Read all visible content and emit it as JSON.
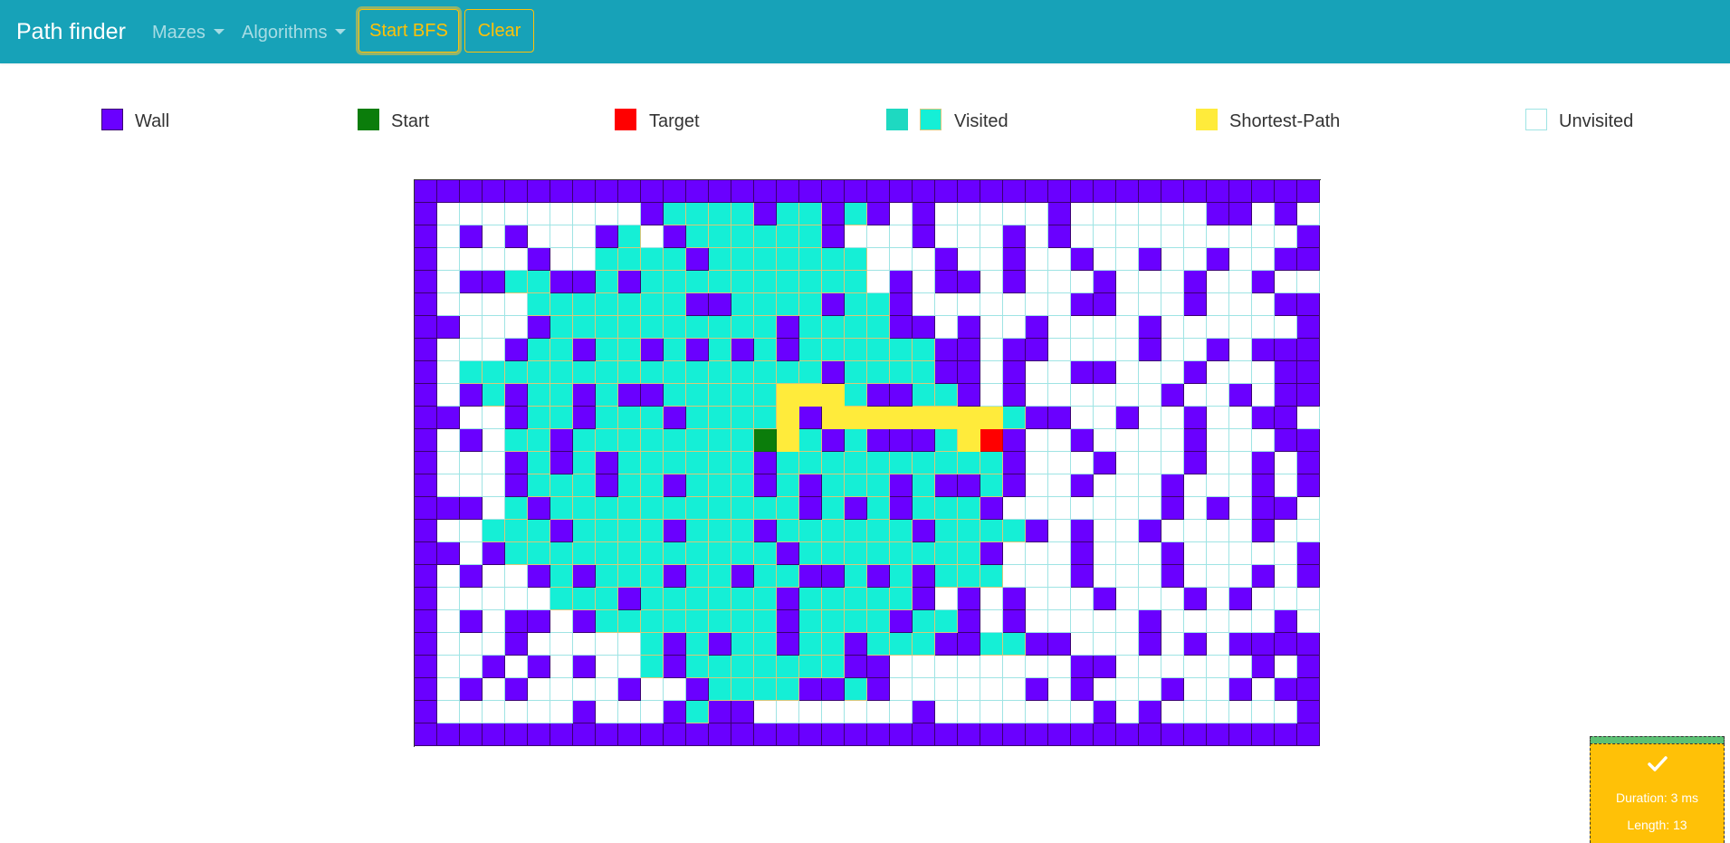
{
  "app": {
    "brand": "Path finder"
  },
  "nav": {
    "mazes": "Mazes",
    "algorithms": "Algorithms",
    "start_button": "Start BFS",
    "clear_button": "Clear"
  },
  "legend": {
    "wall": "Wall",
    "start": "Start",
    "target": "Target",
    "visited": "Visited",
    "shortest_path": "Shortest-Path",
    "unvisited": "Unvisited"
  },
  "colors": {
    "navbar": "#17a2b8",
    "button_accent": "#ffc107",
    "wall": "#6a00ff",
    "start": "#0b7d0b",
    "target": "#ff0000",
    "visited": "#15efd6",
    "visited_alt": "#1ed9c1",
    "shortest_path": "#ffeb3b",
    "unvisited_border": "#9fe4e4"
  },
  "grid": {
    "columns": 40,
    "rows": 25,
    "legend_key": "W wall, S start, T target, V visited, P shortest path, . unvisited",
    "cells": [
      "WWWWWWWWWWWWWWWWWWWWWWWWWWWWWWWWWWWWWWWW",
      "W.........WVVVVWVVWVW.W.....W......WW.W.W",
      "W.W.W...WV.WVVVVVVW...W...W.W..........W",
      "W....W..VVVVWVVVVVVV...W..W..W..W..W..WW",
      "W.WWVVWWVWVVVVVVVVVV.W.WW.W...W...W..W..",
      "W....VVVVVVVWWVVVVWVVW.......WW...W...WW",
      "WW...WVVVVVVVVVVWVVVVWW.W..W....W......W",
      "W...WVVWVVWVWVWVWVVVVVVWW.WW....W..W.WWW",
      "W.VVVVVVVVVVVVVVVVWVVVVWW.W..WW...W...WW",
      "W.WVWVVWVWWVVVVVPPPVWWVVW.W......W..W.WW",
      "WW..WVVWVVVWVVVVPWPPPPPPPPVWW..W..W..WW",
      "W.W.VVWVVVVVVVVSPVWVWWWVPTW..W....W...WW",
      "W...WVWVWVVVVVVWVVVVVVVVVVW...W...W..W.W",
      "W...WVVVWVVWVVVWVWVVVWVWWVW..W...W...W.W",
      "WWW.VWVVVVVVVVVVVWVWVWVVVW.......W.W.WW.",
      "W..VVVWVVVVWVVVWVVVVVVWVVVVW.W..W....W..",
      "WW.WVVVVVVVVVVVVWVVVVVVVVW...W...W.....W",
      "W.W..WVWVVVWVVWVVWWVWVWVVV...W...W...W.W",
      "W.....VVVWVVVVVVWVVVVVW.W.W...W...W.W...W",
      "W.W.WW.WVVVVVVVVWVVVVWVVW.W.....W.....W.",
      "W...W.....VWVWVVWVVWVVVWWVVWW...W.W.WWWW",
      "W..W.W.W..VWVVVVVVVWW........WW......W.W",
      "W.W.W....W..WVVVVWWVW......W.W...W..W.WW",
      "W......W...WVWW.......W.......W.W......W",
      "WWWWWWWWWWWWWWWWWWWWWWWWWWWWWWWWWWWWWWWW"
    ]
  },
  "result": {
    "duration": "Duration: 3 ms",
    "length": "Length: 13"
  }
}
